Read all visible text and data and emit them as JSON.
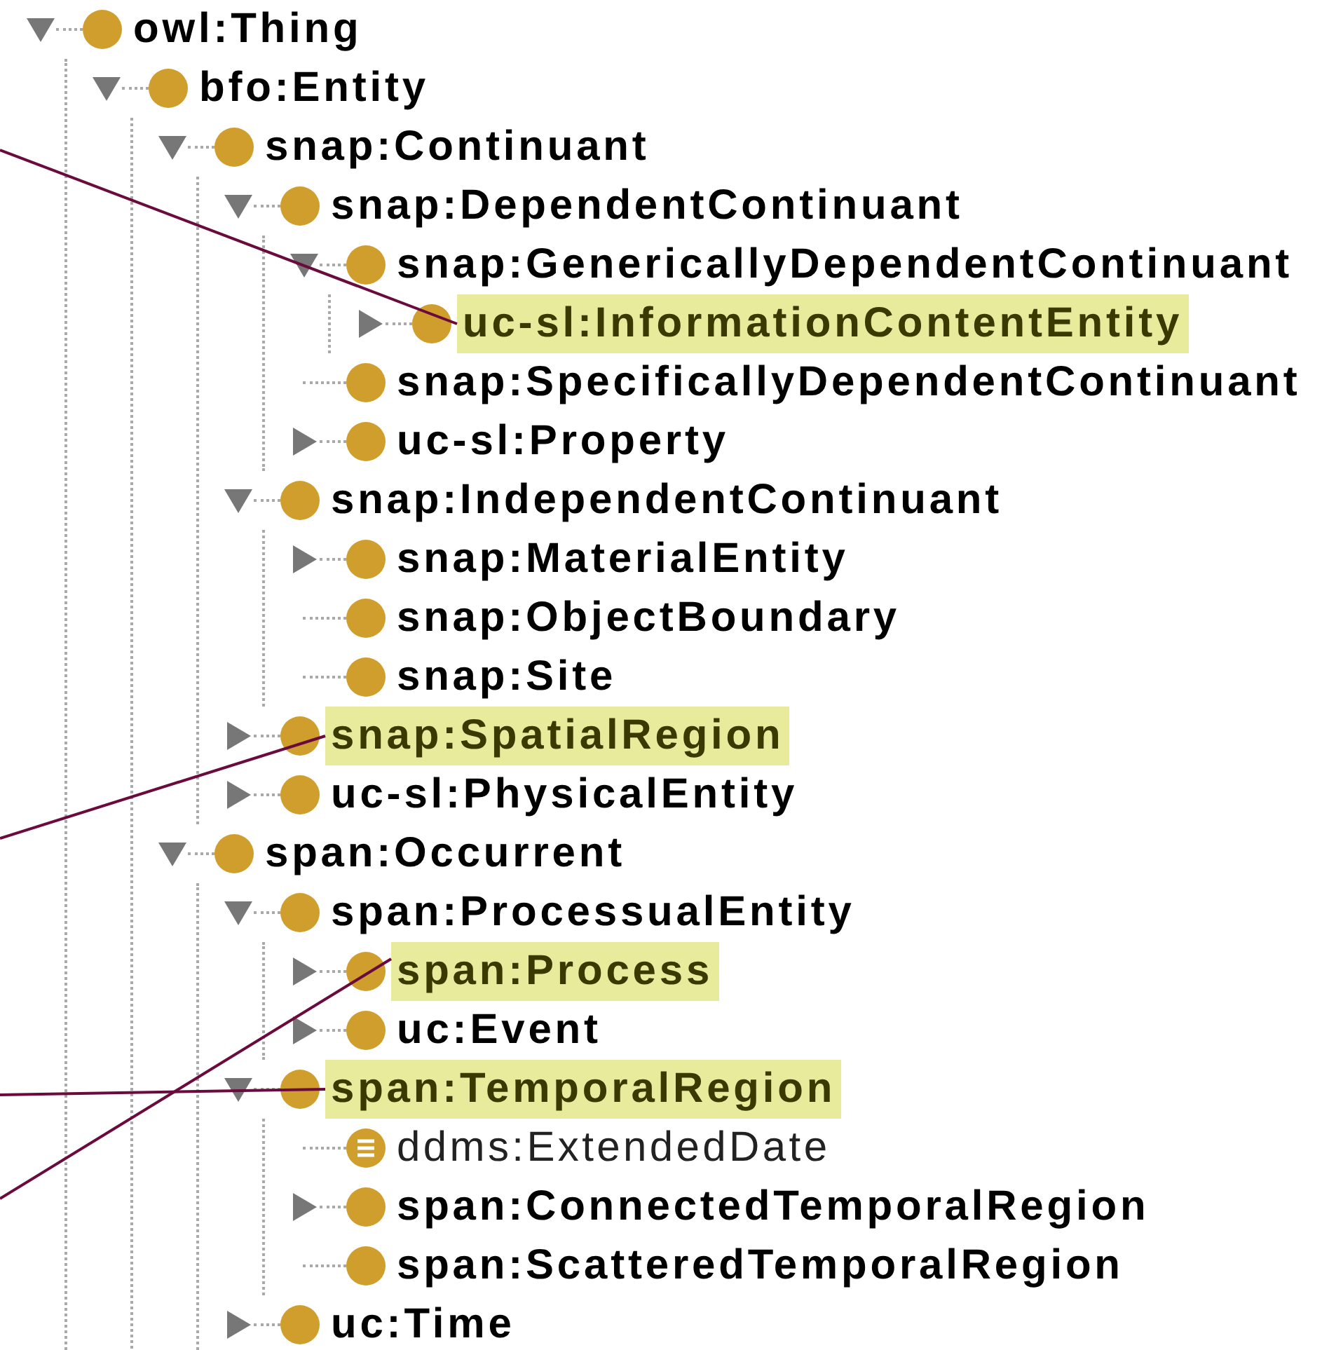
{
  "tree": [
    {
      "label": "owl:Thing",
      "kind": "class",
      "expanded": true,
      "highlighted": false,
      "children": [
        {
          "label": "bfo:Entity",
          "kind": "class",
          "expanded": true,
          "highlighted": false,
          "children": [
            {
              "label": "snap:Continuant",
              "kind": "class",
              "expanded": true,
              "highlighted": false,
              "children": [
                {
                  "label": "snap:DependentContinuant",
                  "kind": "class",
                  "expanded": true,
                  "highlighted": false,
                  "children": [
                    {
                      "label": "snap:GenericallyDependentContinuant",
                      "kind": "class",
                      "expanded": true,
                      "highlighted": false,
                      "children": [
                        {
                          "label": "uc-sl:InformationContentEntity",
                          "kind": "class",
                          "expanded": false,
                          "highlighted": true
                        }
                      ]
                    },
                    {
                      "label": "snap:SpecificallyDependentContinuant",
                      "kind": "class",
                      "highlighted": false
                    },
                    {
                      "label": "uc-sl:Property",
                      "kind": "class",
                      "expanded": false,
                      "highlighted": false
                    }
                  ]
                },
                {
                  "label": "snap:IndependentContinuant",
                  "kind": "class",
                  "expanded": true,
                  "highlighted": false,
                  "children": [
                    {
                      "label": "snap:MaterialEntity",
                      "kind": "class",
                      "expanded": false,
                      "highlighted": false
                    },
                    {
                      "label": "snap:ObjectBoundary",
                      "kind": "class",
                      "highlighted": false
                    },
                    {
                      "label": "snap:Site",
                      "kind": "class",
                      "highlighted": false
                    }
                  ]
                },
                {
                  "label": "snap:SpatialRegion",
                  "kind": "class",
                  "expanded": false,
                  "highlighted": true
                },
                {
                  "label": "uc-sl:PhysicalEntity",
                  "kind": "class",
                  "expanded": false,
                  "highlighted": false
                }
              ]
            },
            {
              "label": "span:Occurrent",
              "kind": "class",
              "expanded": true,
              "highlighted": false,
              "children": [
                {
                  "label": "span:ProcessualEntity",
                  "kind": "class",
                  "expanded": true,
                  "highlighted": false,
                  "children": [
                    {
                      "label": "span:Process",
                      "kind": "class",
                      "expanded": false,
                      "highlighted": true
                    },
                    {
                      "label": "uc:Event",
                      "kind": "class",
                      "expanded": false,
                      "highlighted": false
                    }
                  ]
                },
                {
                  "label": "span:TemporalRegion",
                  "kind": "class",
                  "expanded": true,
                  "highlighted": true,
                  "children": [
                    {
                      "label": "ddms:ExtendedDate",
                      "kind": "individual",
                      "highlighted": false
                    },
                    {
                      "label": "span:ConnectedTemporalRegion",
                      "kind": "class",
                      "expanded": false,
                      "highlighted": false
                    },
                    {
                      "label": "span:ScatteredTemporalRegion",
                      "kind": "class",
                      "highlighted": false
                    }
                  ]
                },
                {
                  "label": "uc:Time",
                  "kind": "class",
                  "expanded": false,
                  "highlighted": false
                }
              ]
            }
          ]
        }
      ]
    }
  ]
}
